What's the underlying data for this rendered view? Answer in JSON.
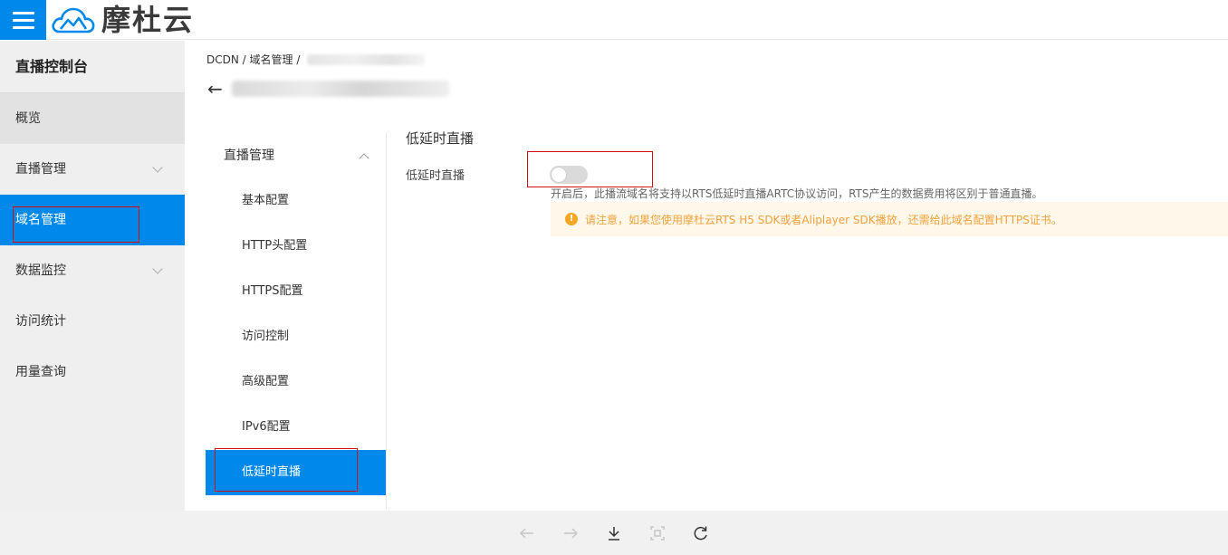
{
  "brand": {
    "name": "摩杜云",
    "accent": "#0089ea",
    "menu_icon": "hamburger-icon",
    "logo_icon": "cloud-logo-icon"
  },
  "sidebar": {
    "title": "直播控制台",
    "items": [
      {
        "label": "概览",
        "state": "hover"
      },
      {
        "label": "直播管理",
        "expandable": true
      },
      {
        "label": "域名管理",
        "active": true
      },
      {
        "label": "数据监控",
        "expandable": true
      },
      {
        "label": "访问统计"
      },
      {
        "label": "用量查询"
      }
    ]
  },
  "breadcrumb": {
    "root": "DCDN",
    "sep": " / ",
    "level2": "域名管理"
  },
  "back_icon": "arrow-left-icon",
  "submenu": {
    "header": "直播管理",
    "items": [
      {
        "label": "基本配置"
      },
      {
        "label": "HTTP头配置"
      },
      {
        "label": "HTTPS配置"
      },
      {
        "label": "访问控制"
      },
      {
        "label": "高级配置"
      },
      {
        "label": "IPv6配置"
      },
      {
        "label": "低延时直播",
        "active": true
      }
    ]
  },
  "content": {
    "section_title": "低延时直播",
    "field_label": "低延时直播",
    "toggle_on": false,
    "description": "开启后，此播流域名将支持以RTS低延时直播ARTC协议访问，RTS产生的数据费用将区别于普通直播。",
    "notice": "请注意，如果您使用摩杜云RTS H5 SDK或者Aliplayer SDK播放，还需给此域名配置HTTPS证书。",
    "notice_icon": "warning-icon",
    "notice_color": "#f0a33c"
  },
  "toolbar": {
    "icons": [
      "back-arrow-icon",
      "forward-arrow-icon",
      "download-icon",
      "fit-screen-icon",
      "refresh-icon"
    ]
  }
}
